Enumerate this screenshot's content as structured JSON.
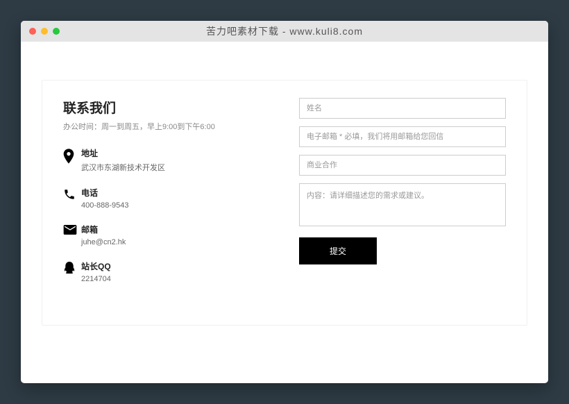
{
  "window": {
    "title": "苦力吧素材下载 - www.kuli8.com"
  },
  "contact": {
    "heading": "联系我们",
    "subheading": "办公时间：周一到周五，早上9:00到下午6:00",
    "items": [
      {
        "label": "地址",
        "value": "武汉市东湖新技术开发区"
      },
      {
        "label": "电话",
        "value": "400-888-9543"
      },
      {
        "label": "邮箱",
        "value": "juhe@cn2.hk"
      },
      {
        "label": "站长QQ",
        "value": "2214704"
      }
    ]
  },
  "form": {
    "name_placeholder": "姓名",
    "email_placeholder": "电子邮箱 * 必填，我们将用邮箱给您回信",
    "subject_placeholder": "商业合作",
    "content_placeholder": "内容：请详细描述您的需求或建议。",
    "submit_label": "提交"
  }
}
